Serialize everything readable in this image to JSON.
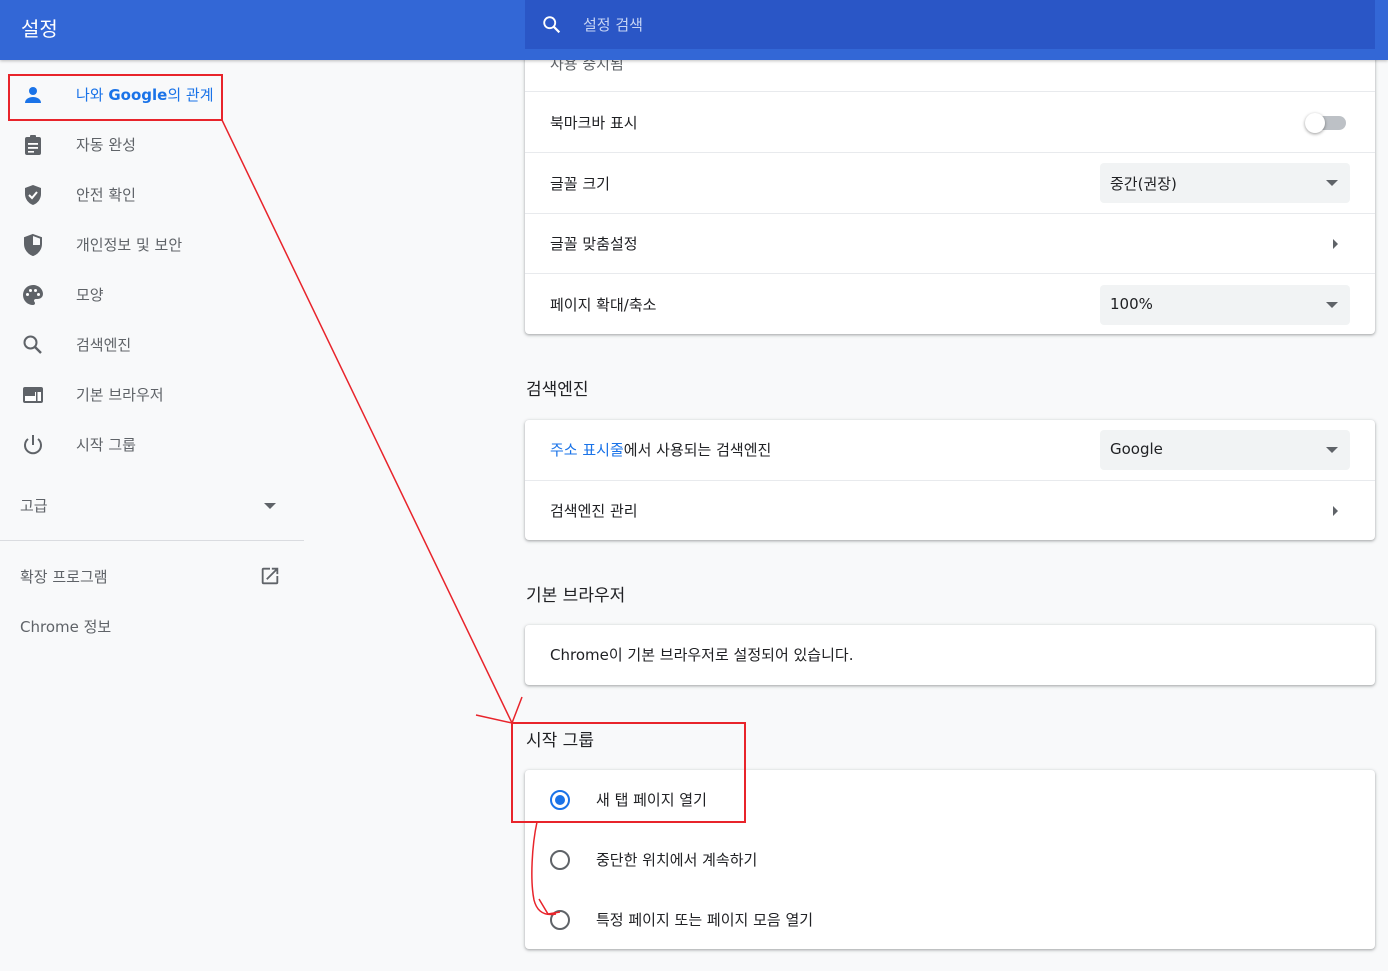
{
  "header": {
    "title": "설정",
    "search_placeholder": "설정 검색"
  },
  "sidebar": {
    "items": [
      {
        "label_pre": "나와 ",
        "label_bold": "Google",
        "label_post": "의 관계",
        "icon": "person-icon"
      },
      {
        "label": "자동 완성",
        "icon": "clipboard-icon"
      },
      {
        "label": "안전 확인",
        "icon": "shield-check-icon"
      },
      {
        "label": "개인정보 및 보안",
        "icon": "shield-half-icon"
      },
      {
        "label": "모양",
        "icon": "palette-icon"
      },
      {
        "label": "검색엔진",
        "icon": "search-icon"
      },
      {
        "label": "기본 브라우저",
        "icon": "browser-window-icon"
      },
      {
        "label": "시작 그룹",
        "icon": "power-icon"
      }
    ],
    "advanced": "고급",
    "extensions": "확장 프로그램",
    "about": "Chrome 정보"
  },
  "appearance_card": {
    "partial_row": "사용 중지됨",
    "bookmark_bar": "북마크바 표시",
    "bookmark_bar_on": false,
    "font_size_label": "글꼴 크기",
    "font_size_value": "중간(권장)",
    "custom_fonts": "글꼴 맞춤설정",
    "zoom_label": "페이지 확대/축소",
    "zoom_value": "100%"
  },
  "search_engine": {
    "title": "검색엔진",
    "row1_link": "주소 표시줄",
    "row1_rest": "에서 사용되는 검색엔진",
    "engine_value": "Google",
    "manage": "검색엔진 관리"
  },
  "default_browser": {
    "title": "기본 브라우저",
    "status": "Chrome이 기본 브라우저로 설정되어 있습니다."
  },
  "on_startup": {
    "title": "시작 그룹",
    "options": [
      {
        "label": "새 탭 페이지 열기",
        "checked": true
      },
      {
        "label": "중단한 위치에서 계속하기",
        "checked": false
      },
      {
        "label": "특정 페이지 또는 페이지 모음 열기",
        "checked": false
      }
    ]
  },
  "colors": {
    "header_bg": "#3367d6",
    "accent": "#1a73e8",
    "annotation": "#e8242b"
  }
}
